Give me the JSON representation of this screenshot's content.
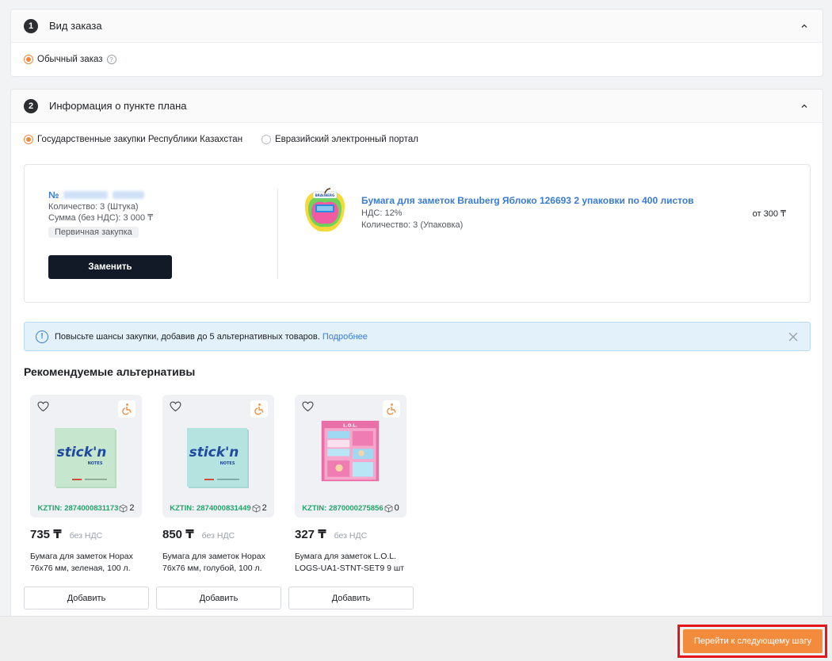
{
  "step1": {
    "number": "1",
    "title": "Вид заказа",
    "option_label": "Обычный заказ",
    "help_icon": "question-circle-icon"
  },
  "step2": {
    "number": "2",
    "title": "Информация о пункте плана",
    "options": [
      {
        "label": "Государственные закупки Республики Казахстан",
        "selected": true
      },
      {
        "label": "Евразийский электронный портал",
        "selected": false
      }
    ],
    "plan": {
      "number_prefix": "№",
      "quantity": "Количество: 3 (Штука)",
      "sum": "Сумма (без НДС): 3 000 ₸",
      "tag": "Первичная закупка",
      "replace_label": "Заменить"
    },
    "product": {
      "title": "Бумага для заметок Brauberg Яблоко 126693 2 упаковки по 400 листов",
      "vat": "НДС: 12%",
      "quantity": "Количество: 3 (Упаковка)",
      "price": "от 300 ₸",
      "brand_text": "BRAUBERG"
    },
    "banner": {
      "text": "Повысьте шансы закупки, добавив до 5 альтернативных товаров.",
      "link": "Подробнее"
    }
  },
  "alternatives": {
    "title": "Рекомендуемые альтернативы",
    "items": [
      {
        "kztin": "KZTIN: 2874000831173",
        "stock": "2",
        "price": "735 ₸",
        "vat": "без НДС",
        "name": "Бумага для заметок Hopax 76х76 мм, зеленая, 100 л.",
        "add_label": "Добавить",
        "brand": "stick'n",
        "brand_sub": "NOTES"
      },
      {
        "kztin": "KZTIN: 2874000831449",
        "stock": "2",
        "price": "850 ₸",
        "vat": "без НДС",
        "name": "Бумага для заметок Hopax 76х76 мм, голубой, 100 л.",
        "add_label": "Добавить",
        "brand": "stick'n",
        "brand_sub": "NOTES"
      },
      {
        "kztin": "KZTIN: 2870000275856",
        "stock": "0",
        "price": "327 ₸",
        "vat": "без НДС",
        "name": "Бумага для заметок L.O.L. LOGS-UA1-STNT-SET9 9 шт",
        "add_label": "Добавить",
        "brand": "L.O.L.",
        "brand_sub": ""
      }
    ]
  },
  "footer": {
    "next_label": "Перейти к следующему шагу"
  },
  "colors": {
    "accent": "#f28b3c",
    "link": "#3a7bd5",
    "kztin": "#22a36a",
    "dark_button": "#131a27",
    "highlight": "#e3161b"
  }
}
